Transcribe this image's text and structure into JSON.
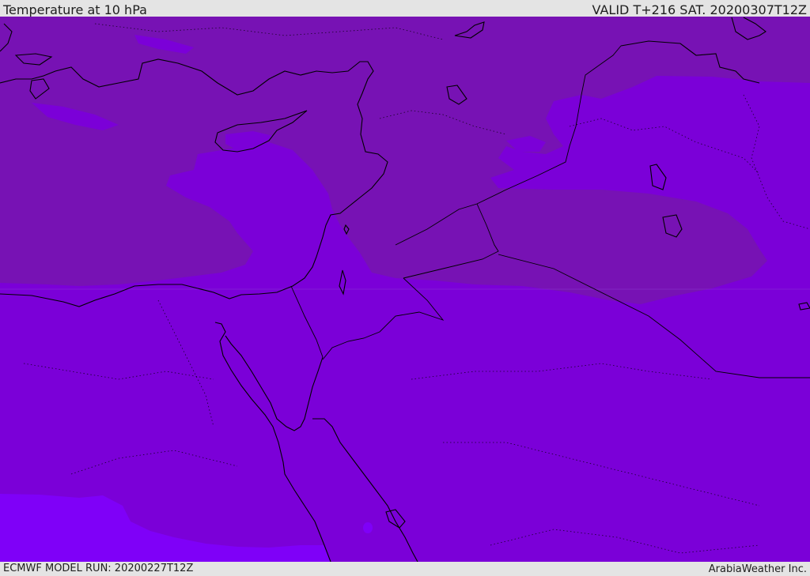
{
  "header": {
    "title": "Temperature at 10 hPa",
    "valid": "VALID T+216 SAT. 20200307T12Z"
  },
  "footer": {
    "model_run": "ECMWF MODEL RUN: 20200227T12Z",
    "credit": "ArabiaWeather Inc."
  },
  "map": {
    "variable": "temperature",
    "level": "10 hPa",
    "region": "Eastern Mediterranean / Middle East",
    "colors": {
      "band_warm": "#7712b4",
      "band_mid": "#7b00d8",
      "band_cool": "#7f00f8",
      "coastline": "#000000",
      "border": "#000000"
    }
  }
}
